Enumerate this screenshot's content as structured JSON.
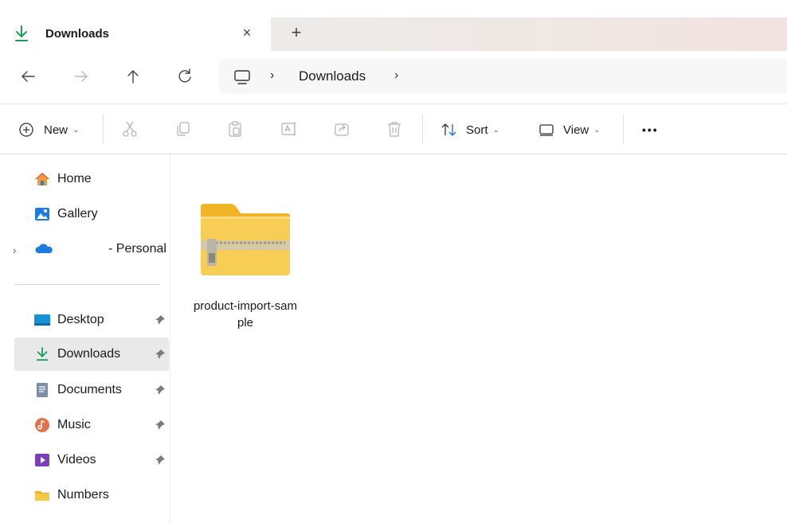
{
  "window": {
    "tab_title": "Downloads",
    "close_glyph": "×",
    "new_tab_glyph": "+"
  },
  "nav": {
    "back_glyph": "←",
    "forward_glyph": "→",
    "up_glyph": "↑",
    "refresh_glyph": "C",
    "address": {
      "separator": "›",
      "crumb": "Downloads"
    }
  },
  "toolbar": {
    "new_label": "New",
    "sort_label": "Sort",
    "view_label": "View",
    "more_label": "•••",
    "chevron": "⌄"
  },
  "sidebar": {
    "items": [
      {
        "label": "Home",
        "icon": "home-icon"
      },
      {
        "label": "Gallery",
        "icon": "gallery-icon"
      },
      {
        "label": "- Personal",
        "icon": "onedrive-icon"
      },
      {
        "label": "Desktop",
        "icon": "desktop-icon",
        "pinned": true
      },
      {
        "label": "Downloads",
        "icon": "download-icon",
        "pinned": true,
        "selected": true
      },
      {
        "label": "Documents",
        "icon": "documents-icon",
        "pinned": true
      },
      {
        "label": "Music",
        "icon": "music-icon",
        "pinned": true
      },
      {
        "label": "Videos",
        "icon": "videos-icon",
        "pinned": true
      },
      {
        "label": "Numbers",
        "icon": "folder-icon"
      }
    ],
    "expand_glyph": "›"
  },
  "content": {
    "files": [
      {
        "name": "product-import-sample",
        "icon": "zip-folder-icon"
      }
    ]
  },
  "colors": {
    "accent": "#1a9c5b",
    "folder_yellow": "#f7c948",
    "selected_bg": "#e9e9e9"
  }
}
